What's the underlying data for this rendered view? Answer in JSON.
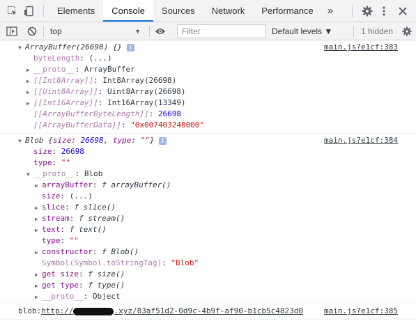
{
  "toolbar": {
    "tabs": [
      "Elements",
      "Console",
      "Sources",
      "Network",
      "Performance"
    ],
    "active_tab": "Console",
    "more_tabs_glyph": "»",
    "icons": [
      "inspect-element-icon",
      "device-toggle-icon",
      "settings-gear-icon",
      "more-vert-icon",
      "close-icon"
    ]
  },
  "filterbar": {
    "context": "top",
    "filter_placeholder": "Filter",
    "levels_label": "Default levels ▼",
    "hidden_count": "1 hidden"
  },
  "messages": [
    {
      "source": "main.js?e1cf:383",
      "header": {
        "name": "ArrayBuffer(26698) {}"
      },
      "rows": [
        {
          "key": "byteLength",
          "sep": ": ",
          "value": "(...)"
        },
        {
          "key": "__proto__",
          "sep": ": ",
          "value": "ArrayBuffer"
        },
        {
          "key": "[[Int8Array]]",
          "sep": ": ",
          "value": "Int8Array(26698)"
        },
        {
          "key": "[[Uint8Array]]",
          "sep": ": ",
          "value": "Uint8Array(26698)"
        },
        {
          "key": "[[Int16Array]]",
          "sep": ": ",
          "value": "Int16Array(13349)"
        },
        {
          "key": "[[ArrayBufferByteLength]]",
          "sep": ": ",
          "value": "26698"
        },
        {
          "key": "[[ArrayBufferData]]",
          "sep": ": ",
          "value": "\"0x007403240000\""
        }
      ]
    },
    {
      "source": "main.js?e1cf:384",
      "header": {
        "name": "Blob",
        "size_key": "size",
        "size_val": "26698",
        "type_key": "type",
        "type_val": "\"\""
      },
      "rows": [
        {
          "key": "size",
          "sep": ": ",
          "value": "26698"
        },
        {
          "key": "type",
          "sep": ": ",
          "value": "\"\""
        },
        {
          "key": "__proto__",
          "sep": ": ",
          "value": "Blob"
        },
        {
          "key": "arrayBuffer",
          "sep": ": ",
          "value": "f arrayBuffer()"
        },
        {
          "key": "size",
          "sep": ": ",
          "value": "(...)"
        },
        {
          "key": "slice",
          "sep": ": ",
          "value": "f slice()"
        },
        {
          "key": "stream",
          "sep": ": ",
          "value": "f stream()"
        },
        {
          "key": "text",
          "sep": ": ",
          "value": "f text()"
        },
        {
          "key": "type",
          "sep": ": ",
          "value": "\"\""
        },
        {
          "key": "constructor",
          "sep": ": ",
          "value": "f Blob()"
        },
        {
          "key": "Symbol(Symbol.toStringTag)",
          "sep": ": ",
          "value": "\"Blob\""
        },
        {
          "key": "get size",
          "sep": ": ",
          "value": "f size()"
        },
        {
          "key": "get type",
          "sep": ": ",
          "value": "f type()"
        },
        {
          "key": "__proto__",
          "sep": ": ",
          "value": "Object"
        }
      ]
    },
    {
      "source": "main.js?e1cf:385",
      "blob_prefix": "blob:",
      "url_start": "http://",
      "url_end": ".xyz/83af51d2-0d9c-4b9f-af90-b1cb5c4823d0"
    }
  ]
}
